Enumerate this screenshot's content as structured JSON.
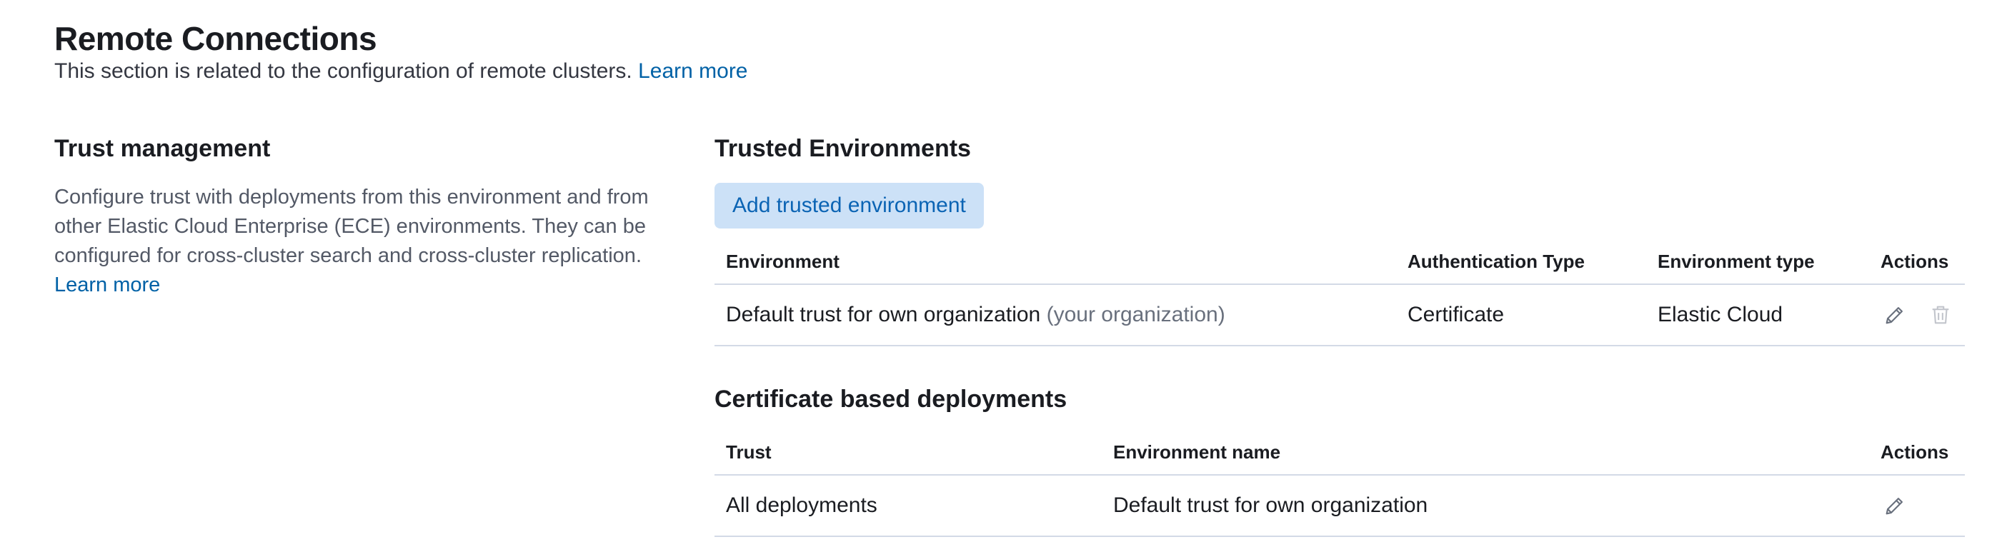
{
  "header": {
    "title": "Remote Connections",
    "subtitle": "This section is related to the configuration of remote clusters.",
    "learn_more": "Learn more"
  },
  "trust_management": {
    "title": "Trust management",
    "description": "Configure trust with deployments from this environment and from other Elastic Cloud Enterprise (ECE) environments. They can be configured for cross-cluster search and cross-cluster replication.",
    "learn_more": "Learn more"
  },
  "trusted_environments": {
    "title": "Trusted Environments",
    "add_button": "Add trusted environment",
    "columns": [
      "Environment",
      "Authentication Type",
      "Environment type",
      "Actions"
    ],
    "rows": [
      {
        "environment": "Default trust for own organization",
        "environment_note": "(your organization)",
        "auth_type": "Certificate",
        "env_type": "Elastic Cloud",
        "actions": [
          "pencil-icon",
          "trash-icon"
        ]
      }
    ]
  },
  "certificate_deployments": {
    "title": "Certificate based deployments",
    "columns": [
      "Trust",
      "Environment name",
      "Actions"
    ],
    "rows": [
      {
        "trust": "All deployments",
        "environment_name": "Default trust for own organization",
        "actions": [
          "pencil-icon"
        ]
      }
    ]
  },
  "colors": {
    "link": "#0061a6",
    "button_bg": "#cce1f7",
    "button_text": "#0b64b4",
    "border": "#d3dae6",
    "muted_text": "#69707d"
  }
}
